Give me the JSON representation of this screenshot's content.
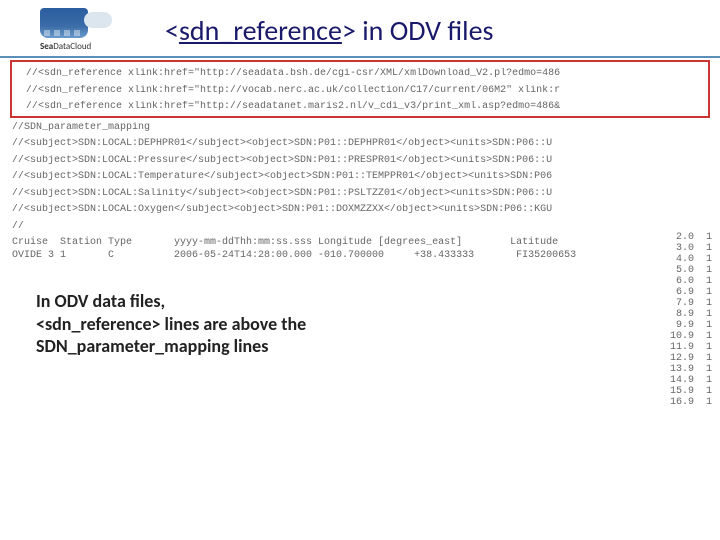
{
  "logo": {
    "line1_bold": "Sea",
    "line1_rest": "Data",
    "line2": "Cloud"
  },
  "title": {
    "tag_open": "<",
    "tag_name": "sdn_reference",
    "tag_close": ">",
    "rest": " in ODV files"
  },
  "refs": [
    "//<sdn_reference xlink:href=\"http://seadata.bsh.de/cgi-csr/XML/xmlDownload_V2.pl?edmo=486",
    "//<sdn_reference xlink:href=\"http://vocab.nerc.ac.uk/collection/C17/current/06M2\" xlink:r",
    "//<sdn_reference xlink:href=\"http://seadatanet.maris2.nl/v_cdi_v3/print_xml.asp?edmo=486&"
  ],
  "mapping": [
    "//SDN_parameter_mapping",
    "//<subject>SDN:LOCAL:DEPHPR01</subject><object>SDN:P01::DEPHPR01</object><units>SDN:P06::U",
    "//<subject>SDN:LOCAL:Pressure</subject><object>SDN:P01::PRESPR01</object><units>SDN:P06::U",
    "//<subject>SDN:LOCAL:Temperature</subject><object>SDN:P01::TEMPPR01</object><units>SDN:P06",
    "//<subject>SDN:LOCAL:Salinity</subject><object>SDN:P01::PSLTZZ01</object><units>SDN:P06::U",
    "//<subject>SDN:LOCAL:Oxygen</subject><object>SDN:P01::DOXMZZXX</object><units>SDN:P06::KGU",
    "//"
  ],
  "columns": "Cruise  Station Type       yyyy-mm-ddThh:mm:ss.sss Longitude [degrees_east]        Latitude ",
  "row": "OVIDE 3 1       C          2006-05-24T14:28:00.000 -010.700000     +38.433333       FI35200653",
  "right_rows": [
    " 2.0  1",
    " 3.0  1",
    " 4.0  1",
    " 5.0  1",
    " 6.0  1",
    " 6.9  1",
    " 7.9  1",
    " 8.9  1",
    " 9.9  1",
    "10.9  1",
    "11.9  1",
    "12.9  1",
    "13.9  1",
    "14.9  1",
    "15.9  1",
    "16.9  1"
  ],
  "caption": {
    "l1": "In ODV data files,",
    "l2a": "<sdn_reference> lines are  above the",
    "l3": "SDN_parameter_mapping lines"
  }
}
